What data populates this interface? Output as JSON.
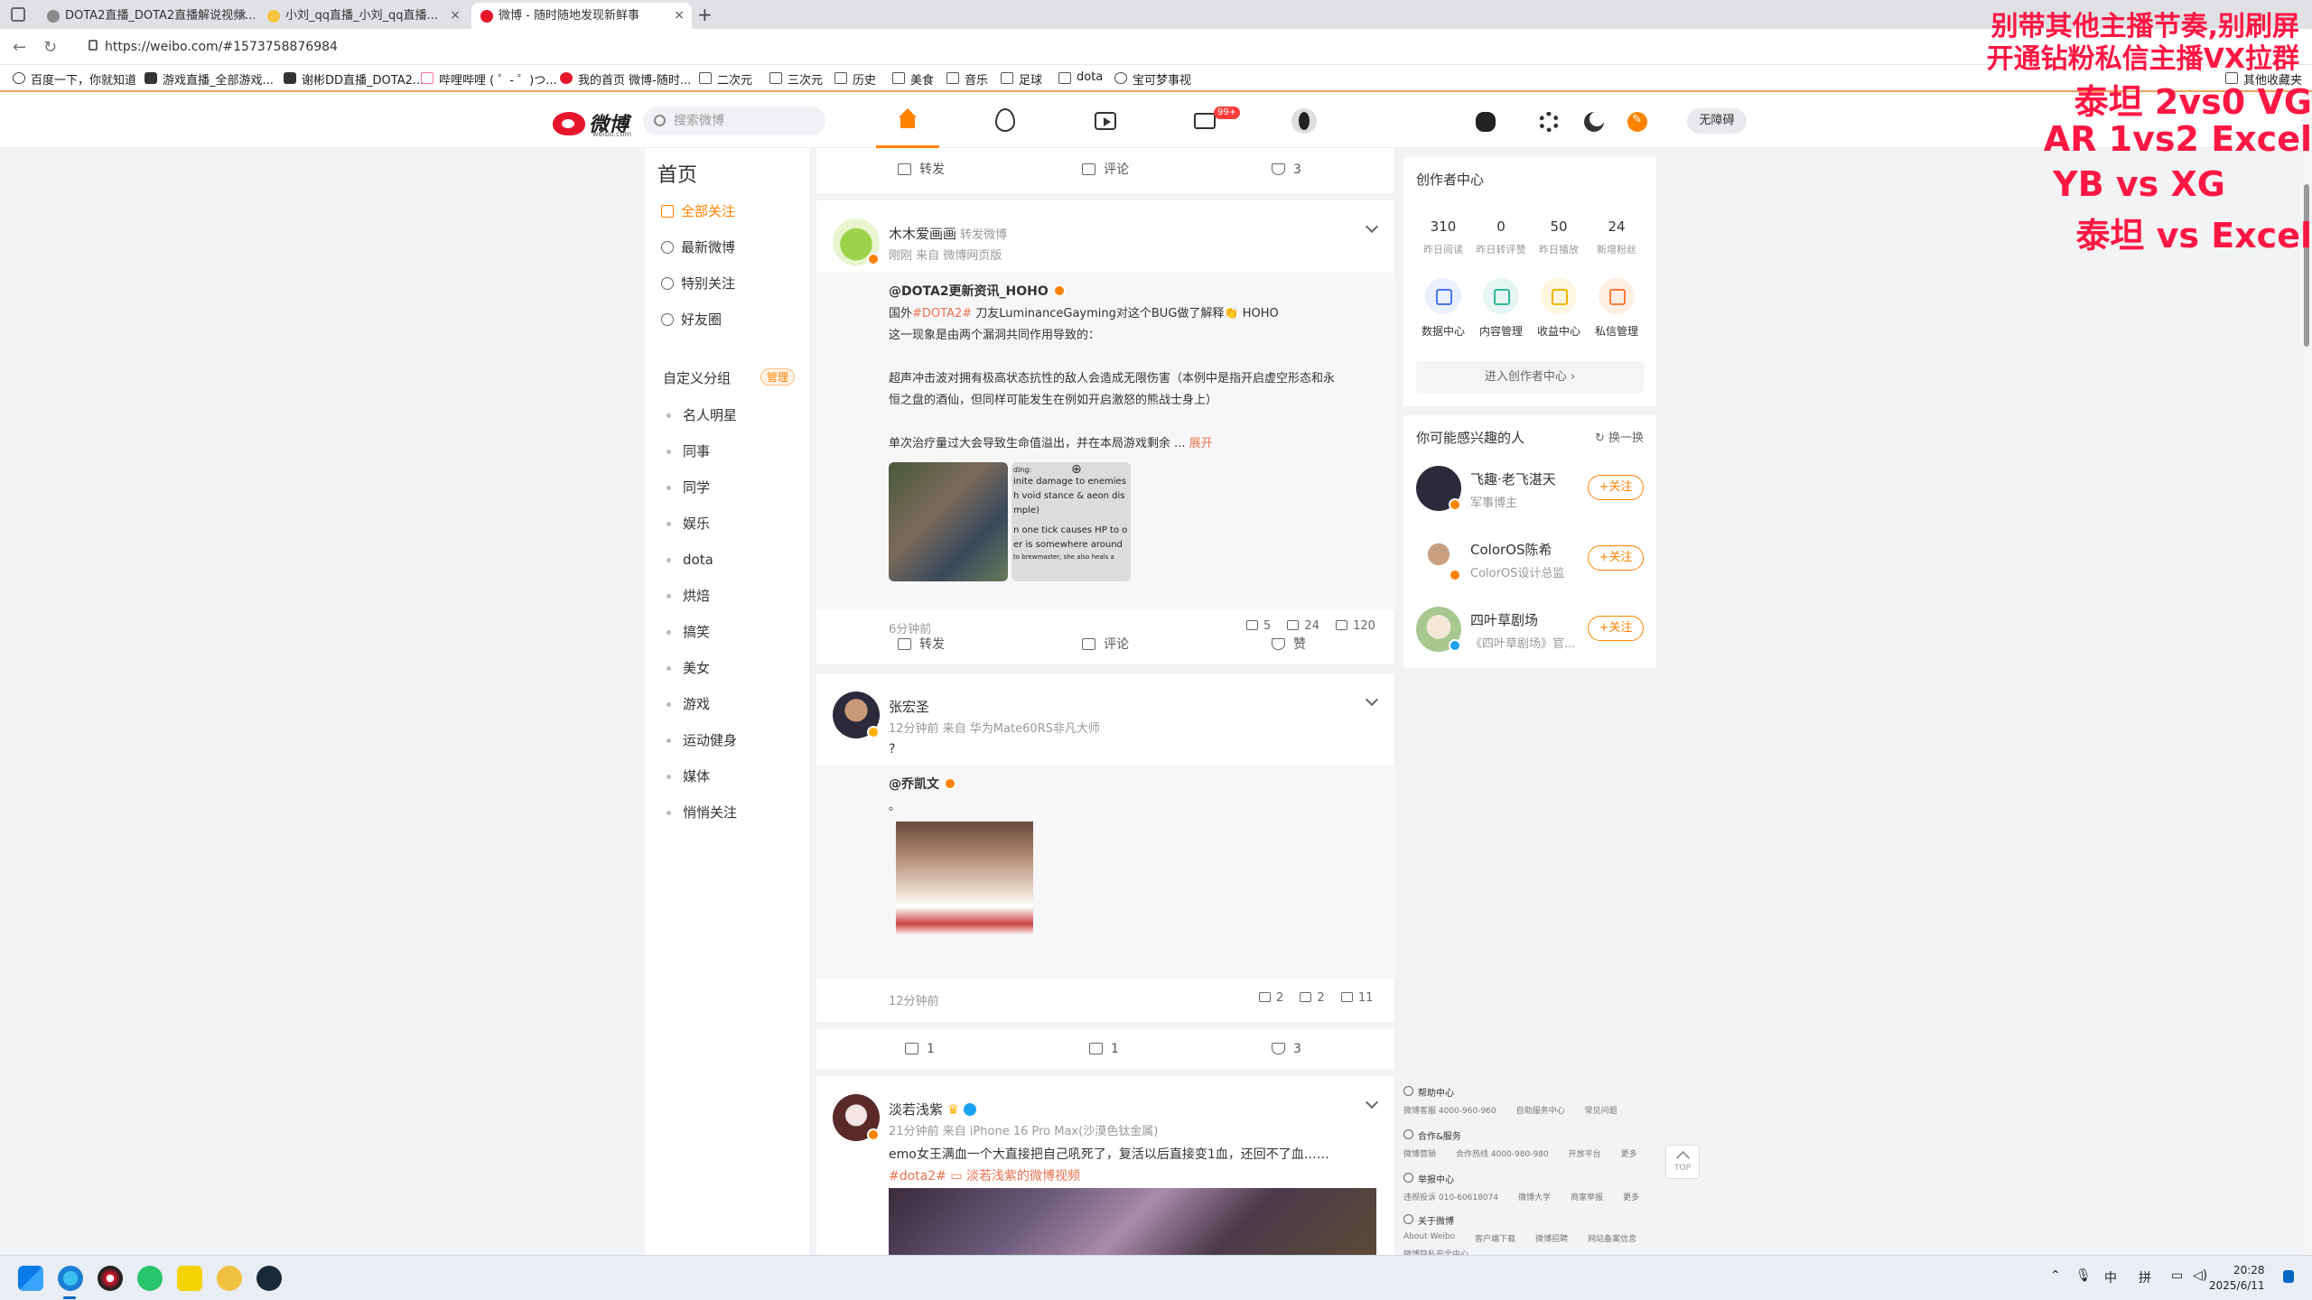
{
  "browser": {
    "tabs": [
      {
        "title": "DOTA2直播_DOTA2直播解说视频...",
        "close": "×"
      },
      {
        "title": "小刘_qq直播_小刘_qq直播...",
        "close": "×"
      },
      {
        "title": "微博 - 随时随地发现新鲜事",
        "close": "×"
      }
    ],
    "new_tab": "+",
    "url": "https://weibo.com/#1573758876984",
    "bookmarks": [
      "百度一下，你就知道",
      "游戏直播_全部游戏...",
      "谢彬DD直播_DOTA2...",
      "哔哩哔哩 ( ゜- ゜)つ...",
      "我的首页 微博-随时...",
      "二次元",
      "三次元",
      "历史",
      "美食",
      "音乐",
      "足球",
      "dota",
      "宝可梦事视"
    ],
    "other_bookmarks": "其他收藏夹"
  },
  "overlay": {
    "line1": "别带其他主播节奏,别刷屏",
    "line2": "开通钻粉私信主播VX拉群",
    "line3": "泰坦 2vs0 VG",
    "line4": "AR 1vs2 Excel",
    "line5": "YB vs XG",
    "line6": "泰坦 vs Excel"
  },
  "header": {
    "logo_text": "微博",
    "logo_sub": "weibo.com",
    "search_placeholder": "搜索微博",
    "msg_badge": "99+",
    "accessibility": "无障碍"
  },
  "left_nav": {
    "title": "首页",
    "items": [
      "全部关注",
      "最新微博",
      "特别关注",
      "好友圈"
    ],
    "group_title": "自定义分组",
    "group_manage": "管理",
    "groups": [
      "名人明星",
      "同事",
      "同学",
      "娱乐",
      "dota",
      "烘焙",
      "搞笑",
      "美女",
      "游戏",
      "运动健身",
      "媒体",
      "悄悄关注"
    ]
  },
  "feed": {
    "top_actions": {
      "repost": "转发",
      "comment": "评论",
      "like": "3"
    },
    "post1": {
      "author": "木木爱画画",
      "author_extra": "转发微博",
      "meta": "刚刚 来自 微博网页版",
      "repost_author": "@DOTA2更新资讯_HOHO",
      "line1_prefix": "国外",
      "line1_tag": "#DOTA2#",
      "line1_suffix": " 刀友LuminanceGayming对这个BUG做了解释👏 HOHO",
      "line2": "这一现象是由两个漏洞共同作用导致的：",
      "line3": "超声冲击波对拥有极高状态抗性的敌人会造成无限伤害（本例中是指开启虚空形态和永",
      "line4": "恒之盘的酒仙，但同样可能发生在例如开启激怒的熊战士身上）",
      "line5": "单次治疗量过大会导致生命值溢出，并在本局游戏剩余 ...",
      "expand": "展开",
      "img2_lines": [
        "ding:",
        "inite damage to enemies",
        "h void stance & aeon dis",
        "mple)",
        "",
        "n one tick causes HP to o",
        "er is somewhere around",
        "to brewmaster, she also heals a"
      ],
      "time": "6分钟前",
      "reposts": "5",
      "comments": "24",
      "likes": "120",
      "act_repost": "转发",
      "act_comment": "评论",
      "act_like": "赞"
    },
    "post2": {
      "author": "张宏圣",
      "meta": "12分钟前 来自 华为Mate60RS非凡大师",
      "text": "?",
      "repost_author": "@乔凯文",
      "repost_text": "。",
      "time": "12分钟前",
      "reposts": "2",
      "comments": "2",
      "likes": "11",
      "act_repost": "1",
      "act_comment": "1",
      "act_like": "3"
    },
    "post3": {
      "author": "淡若浅紫",
      "meta": "21分钟前 来自 iPhone 16 Pro Max(沙漠色钛金属)",
      "text": "emo女王满血一个大直接把自己吼死了，复活以后直接变1血，还回不了血……",
      "tag": "#dota2#",
      "video_link": "淡若浅紫的微博视频"
    }
  },
  "creator": {
    "title": "创作者中心",
    "stats": [
      {
        "value": "310",
        "label": "昨日阅读"
      },
      {
        "value": "0",
        "label": "昨日转评赞"
      },
      {
        "value": "50",
        "label": "昨日播放"
      },
      {
        "value": "24",
        "label": "新增粉丝"
      }
    ],
    "funcs": [
      "数据中心",
      "内容管理",
      "收益中心",
      "私信管理"
    ],
    "enter": "进入创作者中心 ›"
  },
  "suggest": {
    "title": "你可能感兴趣的人",
    "refresh": "换一换",
    "follow": "+关注",
    "people": [
      {
        "name": "飞趣·老飞湛天",
        "desc": "军事博主"
      },
      {
        "name": "ColorOS陈希",
        "desc": "ColorOS设计总监"
      },
      {
        "name": "四叶草剧场",
        "desc": "《四叶草剧场》官..."
      }
    ]
  },
  "footer": {
    "sections": [
      {
        "title": "帮助中心",
        "items": [
          "微博客服 4000-960-960",
          "自助服务中心",
          "常见问题"
        ]
      },
      {
        "title": "合作&服务",
        "items": [
          "微博营销",
          "合作热线 4000-980-980",
          "开放平台",
          "更多"
        ]
      },
      {
        "title": "举报中心",
        "items": [
          "违规投诉 010-60618074",
          "微博大学",
          "商家举报",
          "更多"
        ]
      },
      {
        "title": "关于微博",
        "items": [
          "About Weibo",
          "客户端下载",
          "微博招聘",
          "网站备案信息"
        ]
      }
    ],
    "extra": "微博隐私安全中心",
    "totop": "TOP"
  },
  "taskbar": {
    "tray_ime1": "中",
    "tray_ime2": "拼",
    "time": "20:28",
    "date": "2025/6/11"
  }
}
